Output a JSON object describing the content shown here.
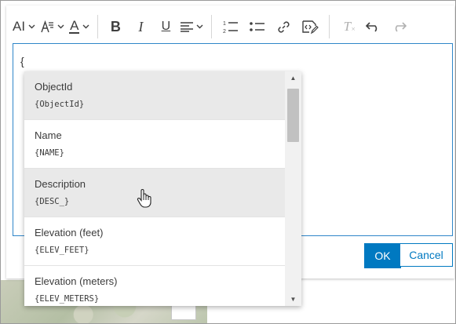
{
  "toolbar": {
    "buttons": [
      {
        "name": "font-size",
        "icon": "font-size-icon",
        "has_caret": true
      },
      {
        "name": "font-family",
        "icon": "font-family-icon",
        "has_caret": true
      },
      {
        "name": "font-color",
        "icon": "font-color-icon",
        "has_caret": true
      },
      {
        "name": "bold",
        "icon": "bold-icon"
      },
      {
        "name": "italic",
        "icon": "italic-icon"
      },
      {
        "name": "underline",
        "icon": "underline-icon"
      },
      {
        "name": "align",
        "icon": "align-left-icon",
        "has_caret": true
      },
      {
        "name": "numbered-list",
        "icon": "numbered-list-icon"
      },
      {
        "name": "bulleted-list",
        "icon": "bulleted-list-icon"
      },
      {
        "name": "link",
        "icon": "link-icon"
      },
      {
        "name": "insert-expression",
        "icon": "code-edit-icon"
      },
      {
        "name": "clear-formatting",
        "icon": "clear-format-icon",
        "disabled": true
      },
      {
        "name": "undo",
        "icon": "undo-icon"
      },
      {
        "name": "redo",
        "icon": "redo-icon",
        "disabled": true
      }
    ],
    "glyphs": {
      "font_size": "AI",
      "bold": "B",
      "italic": "I",
      "underline": "U",
      "font_color": "A",
      "clear": "T"
    }
  },
  "editor": {
    "content": "{"
  },
  "dropdown": {
    "items": [
      {
        "label": "ObjectId",
        "token": "{ObjectId}",
        "highlighted": true
      },
      {
        "label": "Name",
        "token": "{NAME}",
        "highlighted": false
      },
      {
        "label": "Description",
        "token": "{DESC_}",
        "highlighted": true
      },
      {
        "label": "Elevation (feet)",
        "token": "{ELEV_FEET}",
        "highlighted": false
      },
      {
        "label": "Elevation (meters)",
        "token": "{ELEV_METERS}",
        "highlighted": false
      }
    ]
  },
  "actions": {
    "ok_label": "OK",
    "cancel_label": "Cancel"
  },
  "colors": {
    "accent": "#0079c1",
    "editor_border": "#2f86c9",
    "highlight_row": "#e9e9e9"
  }
}
